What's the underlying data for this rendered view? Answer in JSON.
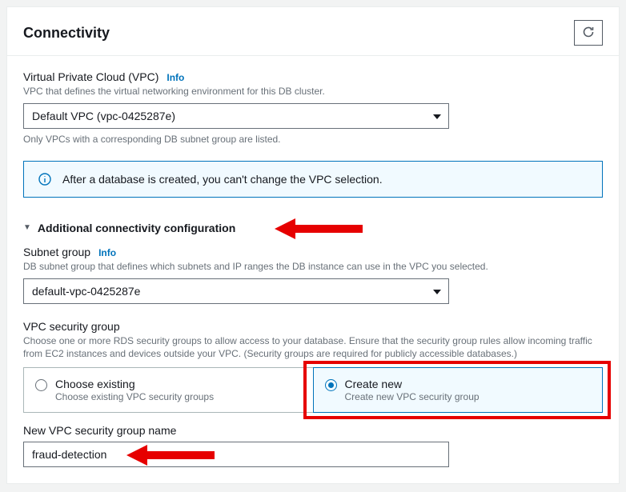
{
  "panel": {
    "title": "Connectivity"
  },
  "vpc": {
    "label": "Virtual Private Cloud (VPC)",
    "info": "Info",
    "desc": "VPC that defines the virtual networking environment for this DB cluster.",
    "value": "Default VPC (vpc-0425287e)",
    "helper": "Only VPCs with a corresponding DB subnet group are listed."
  },
  "notice": {
    "text": "After a database is created, you can't change the VPC selection."
  },
  "additional": {
    "label": "Additional connectivity configuration"
  },
  "subnet": {
    "label": "Subnet group",
    "info": "Info",
    "desc": "DB subnet group that defines which subnets and IP ranges the DB instance can use in the VPC you selected.",
    "value": "default-vpc-0425287e"
  },
  "secgroup": {
    "label": "VPC security group",
    "desc": "Choose one or more RDS security groups to allow access to your database. Ensure that the security group rules allow incoming traffic from EC2 instances and devices outside your VPC. (Security groups are required for publicly accessible databases.)",
    "options": {
      "existing": {
        "title": "Choose existing",
        "sub": "Choose existing VPC security groups"
      },
      "createnew": {
        "title": "Create new",
        "sub": "Create new VPC security group"
      }
    }
  },
  "newsg": {
    "label": "New VPC security group name",
    "value": "fraud-detection"
  }
}
